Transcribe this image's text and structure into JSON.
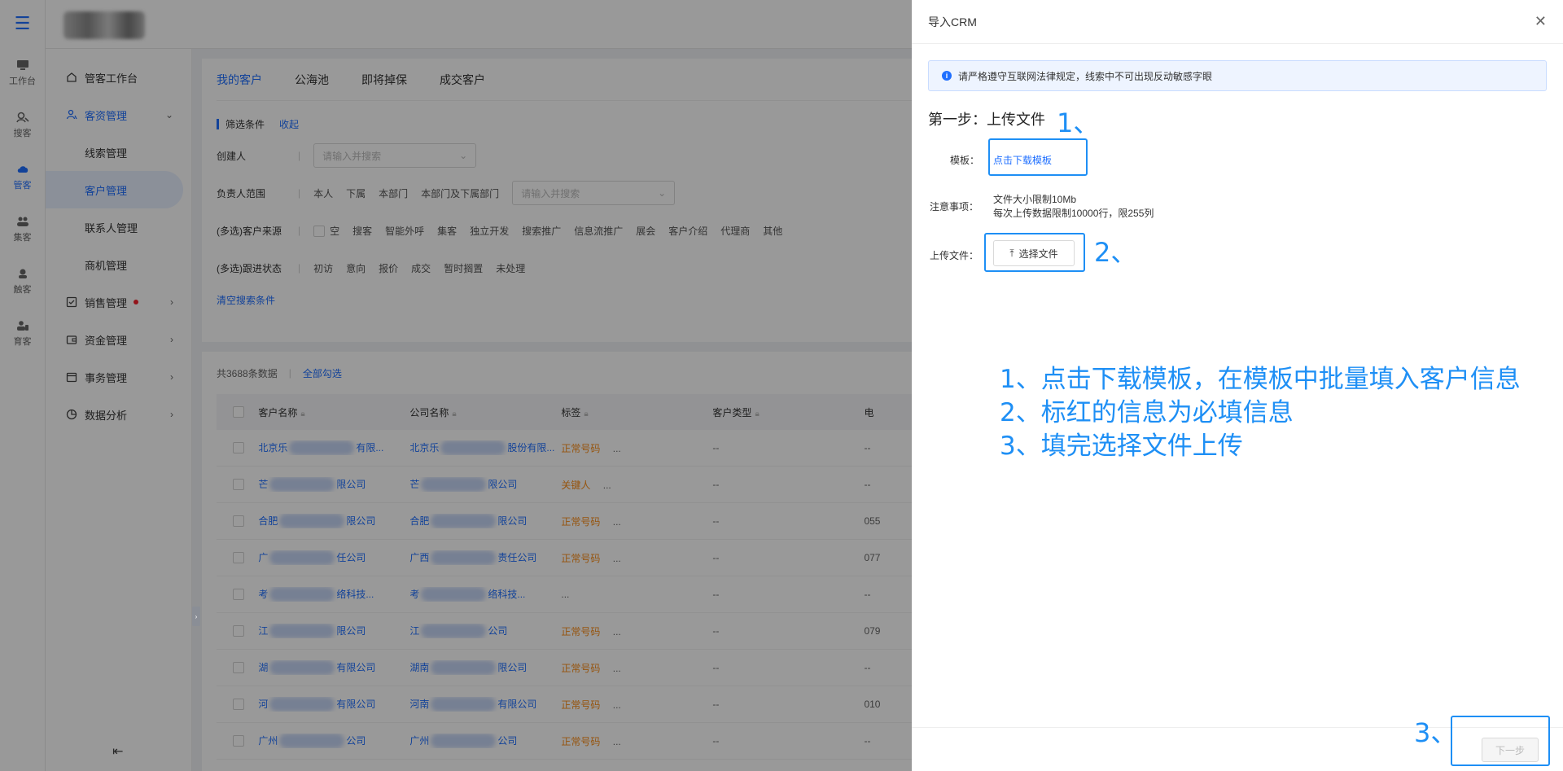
{
  "rail": {
    "items": [
      {
        "label": "工作台",
        "icon": "monitor-icon"
      },
      {
        "label": "搜客",
        "icon": "search-person-icon"
      },
      {
        "label": "管客",
        "icon": "cloud-crm-icon"
      },
      {
        "label": "集客",
        "icon": "group-icon"
      },
      {
        "label": "触客",
        "icon": "headset-icon"
      },
      {
        "label": "育客",
        "icon": "people-icon"
      }
    ]
  },
  "sidebar": {
    "items": [
      {
        "label": "管客工作台",
        "icon": "home-icon"
      },
      {
        "label": "客资管理",
        "icon": "user-icon"
      },
      {
        "label": "线索管理"
      },
      {
        "label": "客户管理"
      },
      {
        "label": "联系人管理"
      },
      {
        "label": "商机管理"
      },
      {
        "label": "销售管理",
        "icon": "checklist-icon"
      },
      {
        "label": "资金管理",
        "icon": "wallet-icon"
      },
      {
        "label": "事务管理",
        "icon": "calendar-icon"
      },
      {
        "label": "数据分析",
        "icon": "pie-icon"
      }
    ]
  },
  "tabs": [
    "我的客户",
    "公海池",
    "即将掉保",
    "成交客户"
  ],
  "filters": {
    "title": "筛选条件",
    "fold": "收起",
    "creator_label": "创建人",
    "search_placeholder": "请输入并搜索",
    "owner_label": "负责人范围",
    "owner_options": [
      "本人",
      "下属",
      "本部门",
      "本部门及下属部门"
    ],
    "source_label": "(多选)客户来源",
    "source_options": [
      "空",
      "搜客",
      "智能外呼",
      "集客",
      "独立开发",
      "搜索推广",
      "信息流推广",
      "展会",
      "客户介绍",
      "代理商",
      "其他"
    ],
    "status_label": "(多选)跟进状态",
    "status_options": [
      "初访",
      "意向",
      "报价",
      "成交",
      "暂时搁置",
      "未处理"
    ],
    "clear": "清空搜索条件"
  },
  "table": {
    "count": "共3688条数据",
    "select_all": "全部勾选",
    "headers": [
      "客户名称",
      "公司名称",
      "标签",
      "客户类型",
      "电"
    ],
    "rows": [
      {
        "name_pre": "北京乐",
        "name_post": "有限...",
        "company_pre": "北京乐",
        "company_post": "股份有限...",
        "tag": "正常号码",
        "tag_color": "orange",
        "more": "...",
        "type": "--",
        "phone": "--"
      },
      {
        "name_pre": "芒",
        "name_post": "限公司",
        "company_pre": "芒",
        "company_post": "限公司",
        "tag": "关键人",
        "tag_color": "orange",
        "more": "...",
        "type": "--",
        "phone": "--"
      },
      {
        "name_pre": "合肥",
        "name_post": "限公司",
        "company_pre": "合肥",
        "company_post": "限公司",
        "tag": "正常号码",
        "tag_color": "orange",
        "more": "...",
        "type": "--",
        "phone": "055"
      },
      {
        "name_pre": "广",
        "name_post": "任公司",
        "company_pre": "广西",
        "company_post": "责任公司",
        "tag": "正常号码",
        "tag_color": "orange",
        "more": "...",
        "type": "--",
        "phone": "077"
      },
      {
        "name_pre": "考",
        "name_post": "络科技...",
        "company_pre": "考",
        "company_post": "络科技...",
        "tag": "...",
        "tag_color": "gray",
        "more": "",
        "type": "--",
        "phone": "--"
      },
      {
        "name_pre": "江",
        "name_post": "限公司",
        "company_pre": "江",
        "company_post": "公司",
        "tag": "正常号码",
        "tag_color": "orange",
        "more": "...",
        "type": "--",
        "phone": "079"
      },
      {
        "name_pre": "湖",
        "name_post": "有限公司",
        "company_pre": "湖南",
        "company_post": "限公司",
        "tag": "正常号码",
        "tag_color": "orange",
        "more": "...",
        "type": "--",
        "phone": "--"
      },
      {
        "name_pre": "河",
        "name_post": "有限公司",
        "company_pre": "河南",
        "company_post": "有限公司",
        "tag": "正常号码",
        "tag_color": "orange",
        "more": "...",
        "type": "--",
        "phone": "010"
      },
      {
        "name_pre": "广州",
        "name_post": "公司",
        "company_pre": "广州",
        "company_post": "公司",
        "tag": "正常号码",
        "tag_color": "orange",
        "more": "...",
        "type": "--",
        "phone": "--"
      }
    ]
  },
  "drawer": {
    "title": "导入CRM",
    "notice": "请严格遵守互联网法律规定，线索中不可出现反动敏感字眼",
    "step_title": "第一步：上传文件",
    "template_label": "模板：",
    "template_link": "点击下载模板",
    "notes_label": "注意事项：",
    "notes": [
      "文件大小限制10Mb",
      "每次上传数据限制10000行，限255列"
    ],
    "upload_label": "上传文件：",
    "upload_button": "选择文件",
    "next_button": "下一步",
    "annotation_markers": [
      "1、",
      "2、",
      "3、"
    ],
    "instructions": [
      "1、点击下载模板，在模板中批量填入客户信息",
      "2、标红的信息为必填信息",
      "3、填完选择文件上传"
    ]
  }
}
